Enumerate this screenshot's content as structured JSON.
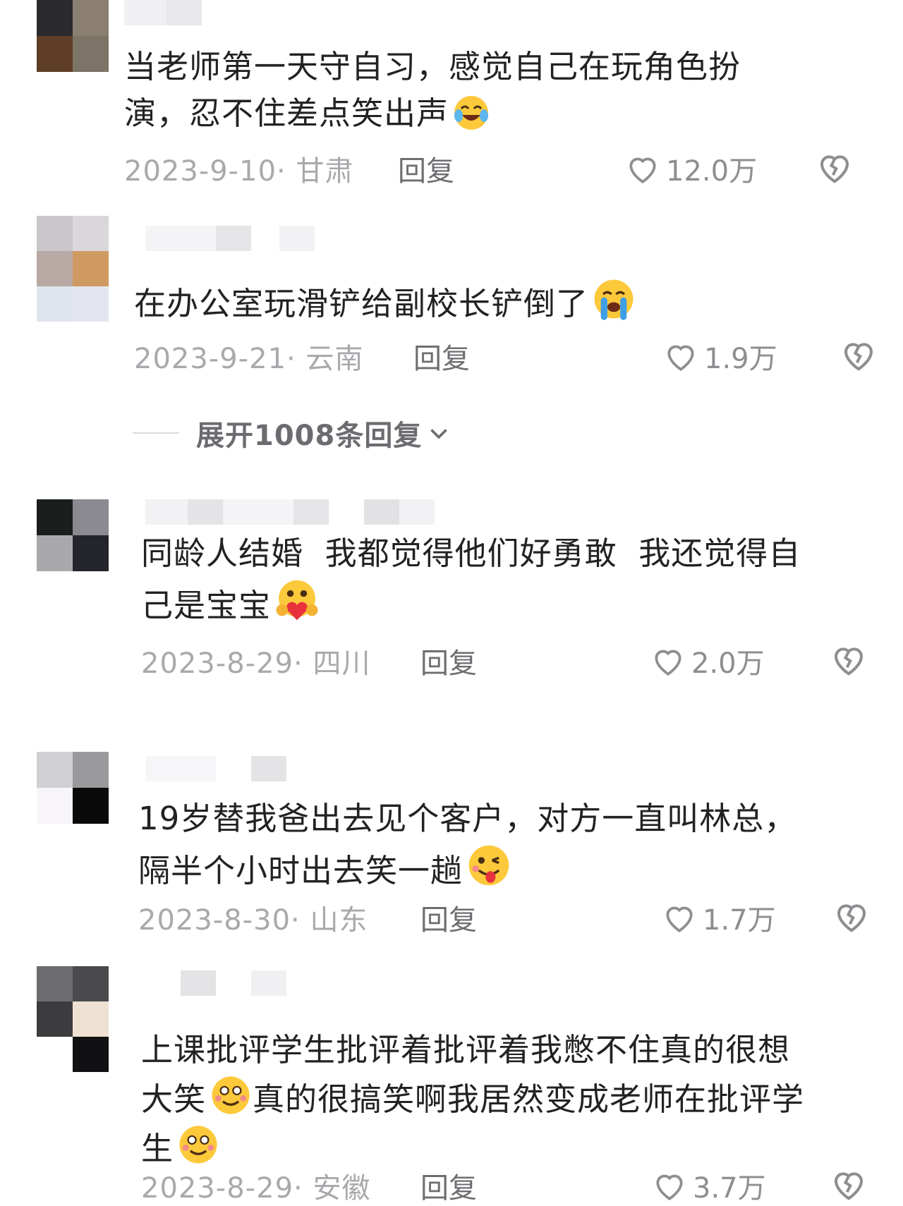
{
  "comments": [
    {
      "text": "当老师第一天守自习，感觉自己在玩角色扮\n演，忍不住差点笑出声",
      "emoji": "laughing-tears-emoji",
      "date": "2023-9-10",
      "location": "甘肃",
      "reply_label": "回复",
      "likes": "12.0万",
      "avatar_colors": [
        "#2b2b2e",
        "#8a7f70",
        "#5e3e26",
        "#7c7466"
      ]
    },
    {
      "text": "在办公室玩滑铲给副校长铲倒了",
      "emoji": "crying-emoji",
      "date": "2023-9-21",
      "location": "云南",
      "reply_label": "回复",
      "likes": "1.9万",
      "avatar_colors": [
        "#c9c7c9",
        "#d9d7d9",
        "#b8a9a4",
        "#cf9a62",
        "#dfe4ee",
        "#e3e6ee"
      ]
    },
    {
      "text": "同龄人结婚  我都觉得他们好勇敢  我还觉得自\n己是宝宝",
      "emoji": "hug-heart-emoji",
      "date": "2023-8-29",
      "location": "四川",
      "reply_label": "回复",
      "likes": "2.0万",
      "avatar_colors": [
        "#1a1e1c",
        "#8a8a90",
        "#a9a9ad",
        "#24242c"
      ]
    },
    {
      "text": "19岁替我爸出去见个客户，对方一直叫林总，\n隔半个小时出去笑一趟",
      "emoji": "wink-tongue-emoji",
      "date": "2023-8-30",
      "location": "山东",
      "reply_label": "回复",
      "likes": "1.7万",
      "avatar_colors": [
        "#d0d0d2",
        "#9a9a9c",
        "#f7f5fa",
        "#0a0a0a"
      ]
    },
    {
      "text": "上课批评学生批评着批评着我憋不住真的很想\n大笑",
      "text2": "真的很搞笑啊我居然变成老师在批评学\n生",
      "emoji": "blush-smile-emoji",
      "date": "2023-8-29",
      "location": "安徽",
      "reply_label": "回复",
      "likes": "3.7万",
      "avatar_colors": [
        "#6c6c6e",
        "#4a4a4c",
        "#3c3c3e",
        "#efe1d2",
        "#ffffff",
        "#111113"
      ]
    }
  ],
  "expand_replies": "展开1008条回复",
  "colors": {
    "meta": "#a9a9ad",
    "reply": "#6e6e72",
    "text": "#222222"
  }
}
